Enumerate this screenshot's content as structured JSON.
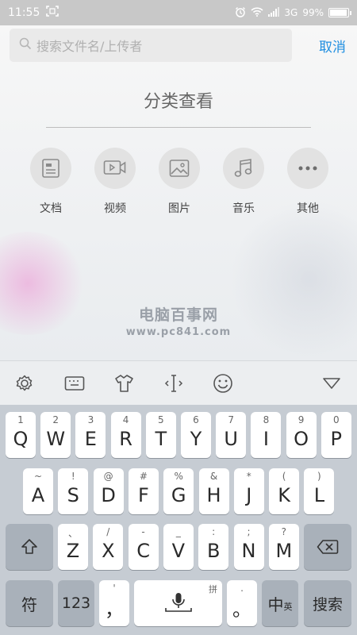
{
  "status": {
    "time": "11:55",
    "network": "3G",
    "battery": "99%",
    "battery_level": 0.99
  },
  "search": {
    "placeholder": "搜索文件名/上传者",
    "cancel_label": "取消"
  },
  "section": {
    "title": "分类查看"
  },
  "categories": [
    {
      "label": "文档",
      "icon": "document-icon"
    },
    {
      "label": "视频",
      "icon": "video-icon"
    },
    {
      "label": "图片",
      "icon": "image-icon"
    },
    {
      "label": "音乐",
      "icon": "music-icon"
    },
    {
      "label": "其他",
      "icon": "more-icon"
    }
  ],
  "watermark": {
    "line1": "电脑百事网",
    "line2": "www.pc841.com"
  },
  "keyboard": {
    "row1": [
      {
        "sup": "1",
        "main": "Q"
      },
      {
        "sup": "2",
        "main": "W"
      },
      {
        "sup": "3",
        "main": "E"
      },
      {
        "sup": "4",
        "main": "R"
      },
      {
        "sup": "5",
        "main": "T"
      },
      {
        "sup": "6",
        "main": "Y"
      },
      {
        "sup": "7",
        "main": "U"
      },
      {
        "sup": "8",
        "main": "I"
      },
      {
        "sup": "9",
        "main": "O"
      },
      {
        "sup": "0",
        "main": "P"
      }
    ],
    "row2": [
      {
        "sup": "~",
        "main": "A"
      },
      {
        "sup": "!",
        "main": "S"
      },
      {
        "sup": "@",
        "main": "D"
      },
      {
        "sup": "#",
        "main": "F"
      },
      {
        "sup": "%",
        "main": "G"
      },
      {
        "sup": "&",
        "main": "H"
      },
      {
        "sup": "*",
        "main": "J"
      },
      {
        "sup": "(",
        "main": "K"
      },
      {
        "sup": ")",
        "main": "L"
      }
    ],
    "row3": [
      {
        "sup": "、",
        "main": "Z"
      },
      {
        "sup": "/",
        "main": "X"
      },
      {
        "sup": "-",
        "main": "C"
      },
      {
        "sup": "_",
        "main": "V"
      },
      {
        "sup": ":",
        "main": "B"
      },
      {
        "sup": ";",
        "main": "N"
      },
      {
        "sup": "?",
        "main": "M"
      }
    ],
    "fu_label": "符",
    "num_label": "123",
    "comma_label": "，",
    "comma_sup": "'",
    "space_sup": "拼",
    "period_label": "。",
    "period_sup": ".",
    "lang_main": "中",
    "lang_sub": "英",
    "search_label": "搜索"
  }
}
